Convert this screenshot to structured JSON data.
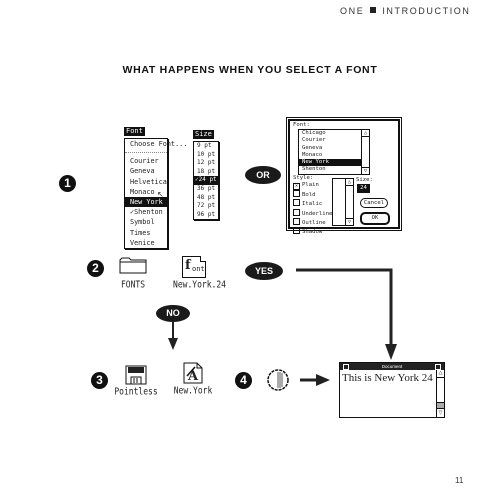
{
  "header": {
    "chapter": "ONE",
    "section": "INTRODUCTION"
  },
  "title": "WHAT HAPPENS WHEN YOU SELECT A FONT",
  "steps": [
    "1",
    "2",
    "3",
    "4"
  ],
  "font_menu": {
    "title": "Font",
    "choose": "Choose Font...",
    "items": [
      "Courier",
      "Geneva",
      "Helvetica",
      "Monaco",
      "New York",
      "✓Shenton",
      "Symbol",
      "Times",
      "Venice"
    ],
    "selected": "New York"
  },
  "size_menu": {
    "title": "Size",
    "items": [
      "9 pt",
      "10 pt",
      "12 pt",
      "18 pt",
      "✓24 pt",
      "36 pt",
      "48 pt",
      "72 pt",
      "96 pt"
    ],
    "selected": "24 pt"
  },
  "or_label": "OR",
  "dialog": {
    "font_label": "Font:",
    "fonts": [
      "Chicago",
      "Courier",
      "Geneva",
      "Monaco",
      "New York",
      "Shenton"
    ],
    "selected_font": "New York",
    "style_label": "Style:",
    "styles": [
      {
        "label": "Plain",
        "checked": true
      },
      {
        "label": "Bold",
        "checked": false
      },
      {
        "label": "Italic",
        "checked": false
      },
      {
        "label": "Underline",
        "checked": false
      },
      {
        "label": "Outline",
        "checked": false
      },
      {
        "label": "Shadow",
        "checked": false
      }
    ],
    "size_label": "Size:",
    "size_value": "24",
    "cancel": "Cancel",
    "ok": "OK"
  },
  "step2": {
    "folder_label": "FONTS",
    "file_label": "New.York.24",
    "file_glyph": "Font"
  },
  "yes_label": "YES",
  "no_label": "NO",
  "step3": {
    "disk_label": "Pointless",
    "file_label": "New.York"
  },
  "window": {
    "title": "Document",
    "content": "This is New York 24"
  },
  "page_number": "11"
}
